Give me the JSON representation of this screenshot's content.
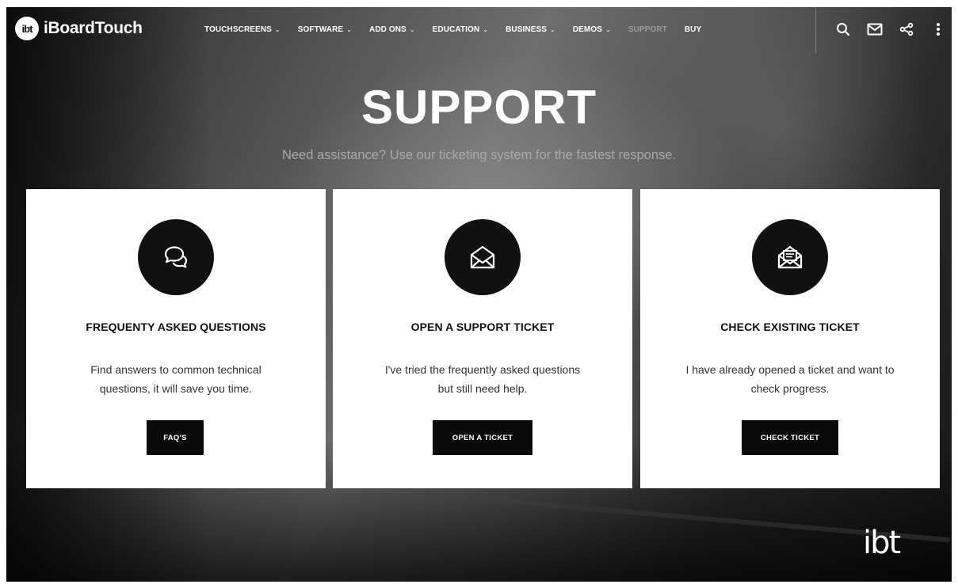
{
  "brand": {
    "logo_mark": "ibt",
    "name": "iBoardTouch",
    "corner_mark": "ibt"
  },
  "nav": {
    "items": [
      {
        "label": "TOUCHSCREENS",
        "chevron": "⌄"
      },
      {
        "label": "SOFTWARE",
        "chevron": "⌄"
      },
      {
        "label": "ADD ONS",
        "chevron": "⌄"
      },
      {
        "label": "EDUCATION",
        "chevron": "⌄"
      },
      {
        "label": "BUSINESS",
        "chevron": "⌄"
      },
      {
        "label": "DEMOS",
        "chevron": "⌄"
      },
      {
        "label": "SUPPORT",
        "chevron": "",
        "active": true
      },
      {
        "label": "BUY",
        "chevron": ""
      }
    ],
    "icons": [
      "search-icon",
      "mail-icon",
      "share-icon",
      "more-vertical-icon"
    ]
  },
  "hero": {
    "title": "SUPPORT",
    "subtitle": "Need assistance? Use our ticketing system for the fastest response."
  },
  "cards": [
    {
      "icon": "chat-bubbles-icon",
      "title": "FREQUENTY ASKED QUESTIONS",
      "desc_line1": "Find answers to common technical",
      "desc_line2": "questions, it will save you time.",
      "button": "FAQ'S"
    },
    {
      "icon": "open-envelope-icon",
      "title": "OPEN A SUPPORT TICKET",
      "desc_line1": "I've tried the frequently asked questions",
      "desc_line2": "but still need help.",
      "button": "OPEN A TICKET"
    },
    {
      "icon": "envelope-letter-icon",
      "title": "CHECK EXISTING TICKET",
      "desc_line1": "I have already opened a ticket and want to",
      "desc_line2": "check progress.",
      "button": "CHECK TICKET"
    }
  ],
  "colors": {
    "card_bg": "#ffffff",
    "button_bg": "#0a0a0a",
    "active_nav": "#9a9a9a"
  }
}
